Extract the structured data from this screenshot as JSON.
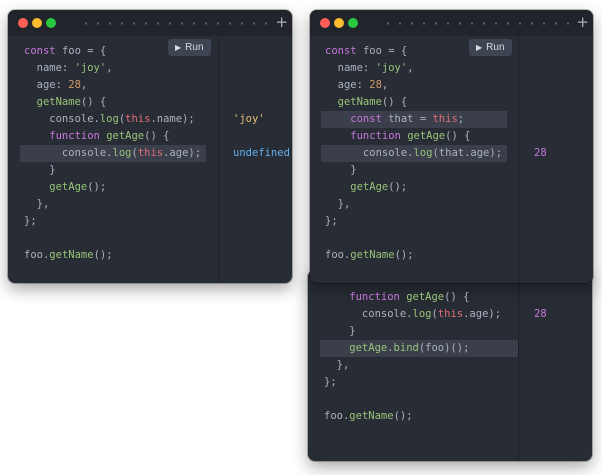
{
  "run_label": "Run",
  "window1": {
    "lines": [
      [
        [
          "kw",
          "const "
        ],
        [
          "plain",
          "foo = {"
        ]
      ],
      [
        [
          "plain",
          "  name: "
        ],
        [
          "str",
          "'joy'"
        ],
        [
          "plain",
          ","
        ]
      ],
      [
        [
          "plain",
          "  age: "
        ],
        [
          "num",
          "28"
        ],
        [
          "plain",
          ","
        ]
      ],
      [
        [
          "fn",
          "  getName"
        ],
        [
          "plain",
          "() {"
        ]
      ],
      [
        [
          "plain",
          "    console."
        ],
        [
          "fn",
          "log"
        ],
        [
          "plain",
          "("
        ],
        [
          "pink",
          "this"
        ],
        [
          "plain",
          ".name);"
        ]
      ],
      [
        [
          "kw",
          "    function "
        ],
        [
          "fn",
          "getAge"
        ],
        [
          "plain",
          "() {"
        ]
      ],
      [
        [
          "plain",
          "      console."
        ],
        [
          "fn",
          "log"
        ],
        [
          "plain",
          "("
        ],
        [
          "pink",
          "this"
        ],
        [
          "plain",
          ".age);"
        ]
      ],
      [
        [
          "plain",
          "    }"
        ]
      ],
      [
        [
          "fn",
          "    getAge"
        ],
        [
          "plain",
          "();"
        ]
      ],
      [
        [
          "plain",
          "  },"
        ]
      ],
      [
        [
          "plain",
          "};"
        ]
      ],
      [
        [
          "plain",
          ""
        ]
      ],
      [
        [
          "plain",
          "foo."
        ],
        [
          "fn",
          "getName"
        ],
        [
          "plain",
          "();"
        ]
      ]
    ],
    "highlight_line": 6,
    "outputs": [
      {
        "line": 4,
        "text": "'joy'",
        "cls": "str"
      },
      {
        "line": 6,
        "text": "undefined",
        "cls": "undef"
      }
    ]
  },
  "window2": {
    "lines": [
      [
        [
          "kw",
          "const "
        ],
        [
          "plain",
          "foo = {"
        ]
      ],
      [
        [
          "plain",
          "  name: "
        ],
        [
          "str",
          "'joy'"
        ],
        [
          "plain",
          ","
        ]
      ],
      [
        [
          "plain",
          "  age: "
        ],
        [
          "num",
          "28"
        ],
        [
          "plain",
          ","
        ]
      ],
      [
        [
          "fn",
          "  getName"
        ],
        [
          "plain",
          "() {"
        ]
      ],
      [
        [
          "kw",
          "    const "
        ],
        [
          "plain",
          "that = "
        ],
        [
          "pink",
          "this"
        ],
        [
          "plain",
          ";"
        ]
      ],
      [
        [
          "kw",
          "    function "
        ],
        [
          "fn",
          "getAge"
        ],
        [
          "plain",
          "() {"
        ]
      ],
      [
        [
          "plain",
          "      console."
        ],
        [
          "fn",
          "log"
        ],
        [
          "plain",
          "(that.age);"
        ]
      ],
      [
        [
          "plain",
          "    }"
        ]
      ],
      [
        [
          "fn",
          "    getAge"
        ],
        [
          "plain",
          "();"
        ]
      ],
      [
        [
          "plain",
          "  },"
        ]
      ],
      [
        [
          "plain",
          "};"
        ]
      ],
      [
        [
          "plain",
          ""
        ]
      ],
      [
        [
          "plain",
          "foo."
        ],
        [
          "fn",
          "getName"
        ],
        [
          "plain",
          "();"
        ]
      ]
    ],
    "highlight_lines": [
      4,
      6
    ],
    "outputs": [
      {
        "line": 6,
        "text": "28",
        "cls": "num"
      }
    ]
  },
  "window3": {
    "lines": [
      [
        [
          "kw",
          "    function "
        ],
        [
          "fn",
          "getAge"
        ],
        [
          "plain",
          "() {"
        ]
      ],
      [
        [
          "plain",
          "      console."
        ],
        [
          "fn",
          "log"
        ],
        [
          "plain",
          "("
        ],
        [
          "pink",
          "this"
        ],
        [
          "plain",
          ".age);"
        ]
      ],
      [
        [
          "plain",
          "    }"
        ]
      ],
      [
        [
          "fn",
          "    getAge"
        ],
        [
          "plain",
          "."
        ],
        [
          "fn",
          "bind"
        ],
        [
          "plain",
          "(foo)();"
        ]
      ],
      [
        [
          "plain",
          "  },"
        ]
      ],
      [
        [
          "plain",
          "};"
        ]
      ],
      [
        [
          "plain",
          ""
        ]
      ],
      [
        [
          "plain",
          "foo."
        ],
        [
          "fn",
          "getName"
        ],
        [
          "plain",
          "();"
        ]
      ]
    ],
    "highlight_line": 3,
    "outputs": [
      {
        "line": 1,
        "text": "28",
        "cls": "num"
      }
    ]
  }
}
